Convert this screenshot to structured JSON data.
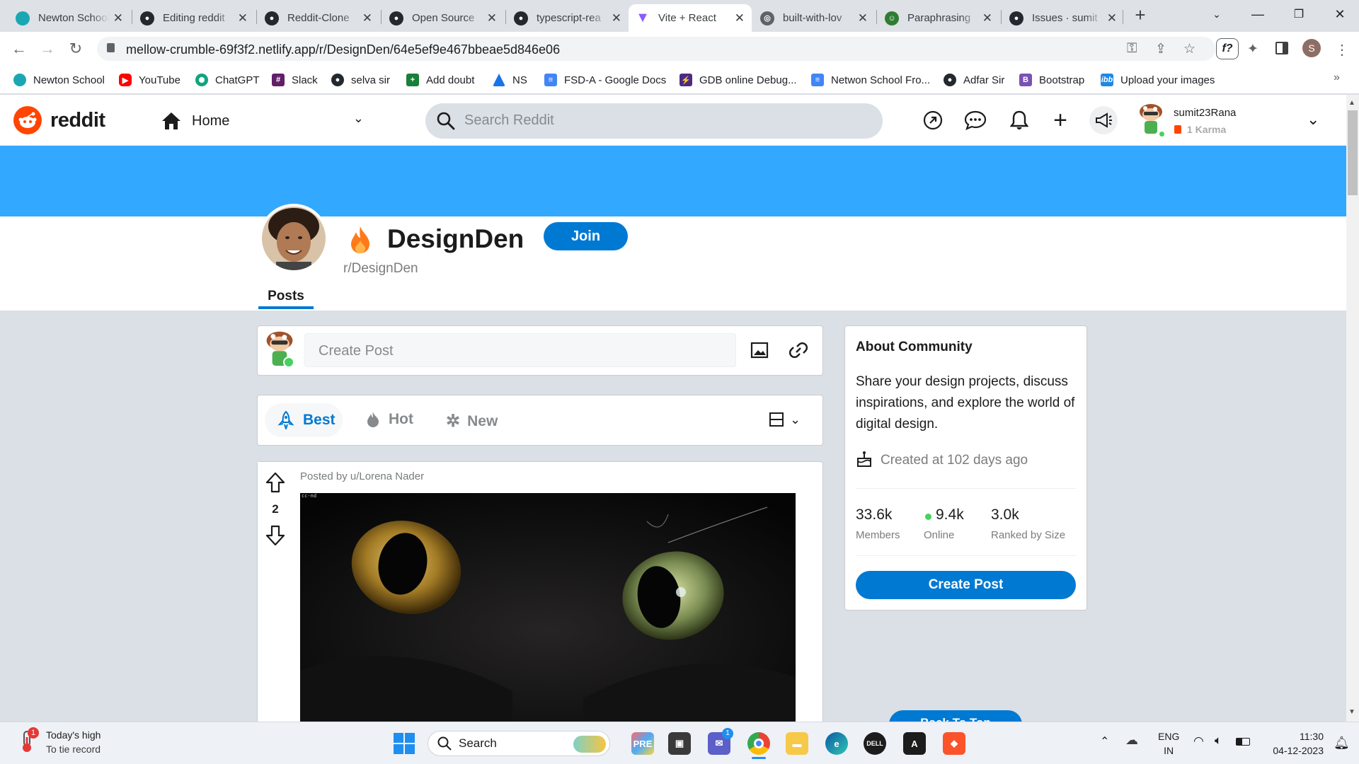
{
  "browser": {
    "tabs": [
      {
        "label": "Newton School",
        "color": "#1aa7b3"
      },
      {
        "label": "Editing reddit",
        "color": "#24292f"
      },
      {
        "label": "Reddit-Clone",
        "color": "#24292f"
      },
      {
        "label": "Open Source",
        "color": "#24292f"
      },
      {
        "label": "typescript-rea",
        "color": "#24292f"
      },
      {
        "label": "Vite + React",
        "color": "#8b5cf6"
      },
      {
        "label": "built-with-lov",
        "color": "#5f6368"
      },
      {
        "label": "Paraphrasing",
        "color": "#2e7d32"
      },
      {
        "label": "Issues · sumit",
        "color": "#24292f"
      }
    ],
    "url": "mellow-crumble-69f3f2.netlify.app/r/DesignDen/64e5ef9e467bbeae5d846e06",
    "profile_initial": "S",
    "ext_label": "f?",
    "bookmarks": [
      {
        "label": "Newton School",
        "color": "#1aa7b3"
      },
      {
        "label": "YouTube",
        "color": "#ff0000"
      },
      {
        "label": "ChatGPT",
        "color": "#10a37f"
      },
      {
        "label": "Slack",
        "color": "#611f69"
      },
      {
        "label": "selva sir",
        "color": "#24292f"
      },
      {
        "label": "Add doubt",
        "color": "#188038"
      },
      {
        "label": "NS",
        "color": "#1a73e8"
      },
      {
        "label": "FSD-A - Google Docs",
        "color": "#4285f4"
      },
      {
        "label": "GDB online Debug...",
        "color": "#4b2c84"
      },
      {
        "label": "Netwon School Fro...",
        "color": "#4285f4"
      },
      {
        "label": "Adfar Sir",
        "color": "#24292f"
      },
      {
        "label": "Bootstrap",
        "color": "#7952b3"
      },
      {
        "label": "Upload your images",
        "color": "#1e88e5"
      }
    ]
  },
  "reddit": {
    "logo_text": "reddit",
    "nav_home": "Home",
    "search_placeholder": "Search Reddit",
    "user": {
      "name": "sumit23Rana",
      "karma": "1 Karma"
    },
    "community": {
      "name": "DesignDen",
      "slug": "r/DesignDen",
      "join_label": "Join",
      "tab_posts": "Posts"
    },
    "create_post_placeholder": "Create Post",
    "sort": {
      "best": "Best",
      "hot": "Hot",
      "new": "New"
    },
    "post": {
      "author_line": "Posted by u/Lorena Nader",
      "votes": "2",
      "image_watermark": "cc-nd"
    },
    "about": {
      "title": "About Community",
      "description": "Share your design projects, discuss inspirations, and explore the world of digital design.",
      "created": "Created at 102 days ago",
      "members_value": "33.6k",
      "members_label": "Members",
      "online_value": "9.4k",
      "online_label": "Online",
      "ranked_value": "3.0k",
      "ranked_label": "Ranked by Size",
      "create_post_btn": "Create Post",
      "back_to_top": "Back To Top"
    },
    "colors": {
      "brand": "#ff4500",
      "banner": "#33a8ff",
      "blue": "#0079d3",
      "online": "#46d160"
    }
  },
  "taskbar": {
    "weather_title": "Today's high",
    "weather_sub": "To tie record",
    "weather_badge": "1",
    "search_label": "Search",
    "lang_top": "ENG",
    "lang_bottom": "IN",
    "time": "11:30",
    "date": "04-12-2023"
  }
}
